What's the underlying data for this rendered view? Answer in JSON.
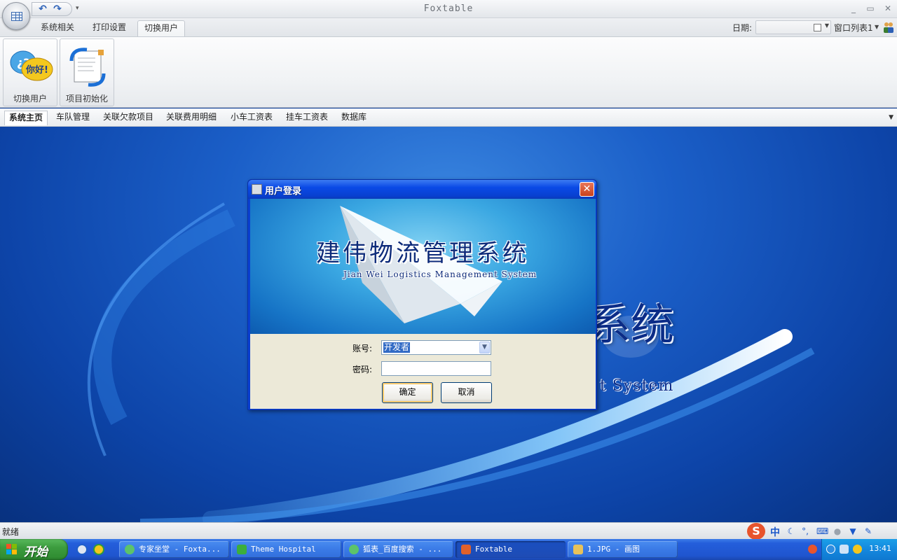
{
  "app": {
    "title": "Foxtable"
  },
  "window_controls": {
    "minimize": "_",
    "restore": "▭",
    "close": "✕"
  },
  "quick_access": {
    "undo": "↶",
    "redo": "↷",
    "more": "▾"
  },
  "ribbon": {
    "tabs": [
      {
        "label": "系统相关",
        "active": false
      },
      {
        "label": "打印设置",
        "active": false
      },
      {
        "label": "切换用户",
        "active": true
      }
    ],
    "date_label": "日期:",
    "date_value": "",
    "window_list_label": "窗口列表1",
    "buttons": [
      {
        "label": "切换用户",
        "icon": "hello-speech-bubble-icon",
        "icon_text": "你好!"
      },
      {
        "label": "项目初始化",
        "icon": "document-refresh-icon"
      }
    ]
  },
  "page_tabs": [
    {
      "label": "系统主页",
      "active": true
    },
    {
      "label": "车队管理",
      "active": false
    },
    {
      "label": "关联欠款项目",
      "active": false
    },
    {
      "label": "关联费用明细",
      "active": false
    },
    {
      "label": "小车工资表",
      "active": false
    },
    {
      "label": "挂车工资表",
      "active": false
    },
    {
      "label": "数据库",
      "active": false
    }
  ],
  "background": {
    "title_fragment": "系统",
    "subtitle_fragment": "t System"
  },
  "login_dialog": {
    "title": "用户登录",
    "close_glyph": "✕",
    "banner_title": "建伟物流管理系统",
    "banner_subtitle": "Jian Wei Logistics Management System",
    "account_label": "账号:",
    "account_value": "开发者",
    "password_label": "密码:",
    "password_value": "",
    "ok_label": "确定",
    "cancel_label": "取消"
  },
  "statusbar": {
    "text": "就绪",
    "ime": {
      "logo": "S",
      "mode": "中",
      "icons": [
        "moon-icon",
        "punctuation-icon",
        "keyboard-icon",
        "user-icon",
        "shirt-icon",
        "wrench-icon"
      ]
    }
  },
  "taskbar": {
    "start_label": "开始",
    "tasks": [
      {
        "label": "专家坐堂 - Foxta...",
        "icon": "browser-icon",
        "color": "#5cc36a",
        "active": false
      },
      {
        "label": "Theme Hospital",
        "icon": "hospital-cross-icon",
        "color": "#3cae3c",
        "active": false
      },
      {
        "label": "狐表_百度搜索 - ...",
        "icon": "browser-icon",
        "color": "#5cc36a",
        "active": false
      },
      {
        "label": "Foxtable",
        "icon": "foxtable-icon",
        "color": "#e0612b",
        "active": true
      },
      {
        "label": "1.JPG - 画图",
        "icon": "paint-icon",
        "color": "#e8c25a",
        "active": false
      }
    ],
    "clock": "13:41"
  },
  "colors": {
    "desktop_blue": "#0d44a8",
    "dialog_title_blue": "#0a4ae6",
    "taskbar_blue": "#245edb",
    "start_green": "#3c9c3e"
  }
}
